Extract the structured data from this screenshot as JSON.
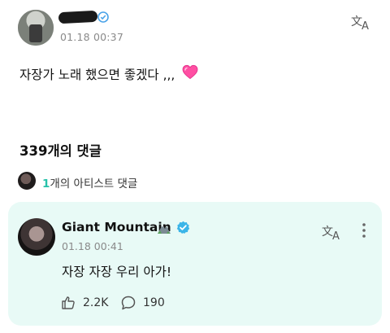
{
  "post": {
    "time": "01.18 00:37",
    "text": "자장가 노래 했으면 좋겠다 ,,,",
    "heart_icon": "pink-heart-icon"
  },
  "comments": {
    "title": "339개의 댓글",
    "artist_count": "1",
    "artist_label": "개의 아티스트 댓글"
  },
  "artist_comment": {
    "author": "Giant Mountain",
    "time": "01.18 00:41",
    "text": "자장 자장 우리 아가!",
    "likes": "2.2K",
    "replies": "190"
  },
  "colors": {
    "accent": "#27c1a9",
    "card_bg": "#e8faf6",
    "verified": "#3bb5e8"
  }
}
